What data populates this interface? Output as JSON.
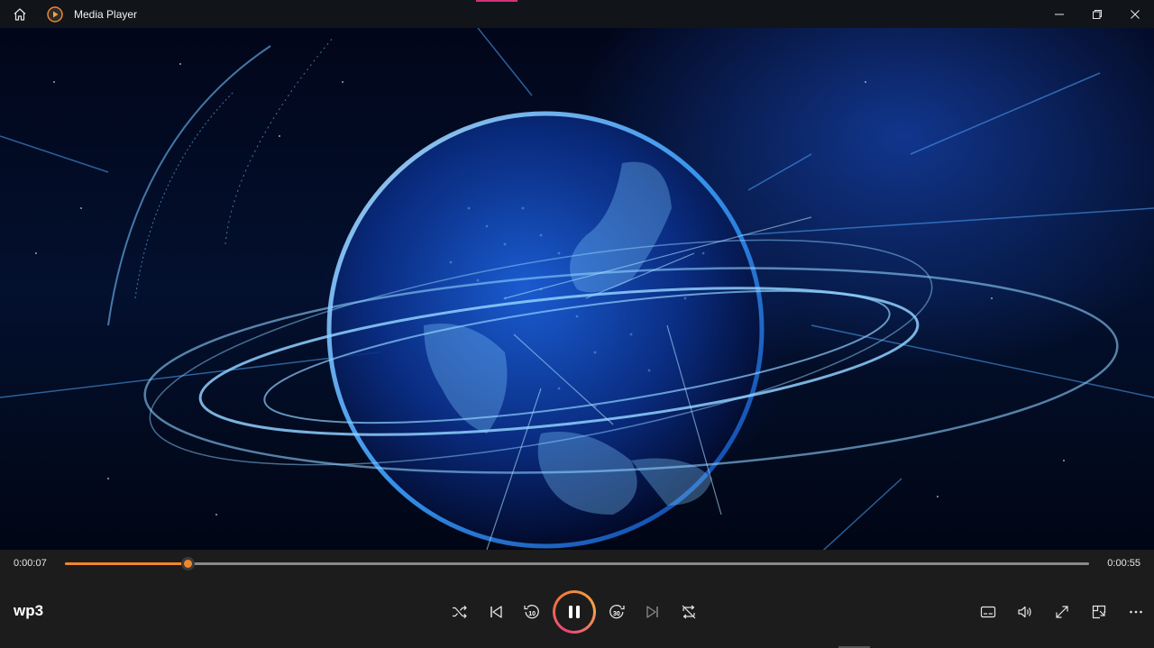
{
  "window": {
    "title": "Media Player",
    "icons": {
      "home": "home-icon",
      "app": "media-player-icon",
      "minimize": "minimize-icon",
      "restore": "restore-icon",
      "close": "close-icon"
    }
  },
  "player": {
    "current_time": "0:00:07",
    "total_time": "0:00:55",
    "progress_fraction": 0.12,
    "media_title": "wp3",
    "skip_back_seconds": "10",
    "skip_forward_seconds": "30",
    "accent_color": "#f0862a",
    "controls_center": [
      "shuffle-icon",
      "previous-icon",
      "skip-back-10-icon",
      "pause-icon",
      "skip-forward-30-icon",
      "next-icon",
      "repeat-icon"
    ],
    "controls_right": [
      "captions-icon",
      "volume-icon",
      "fullscreen-icon",
      "mini-player-icon",
      "more-options-icon"
    ]
  }
}
